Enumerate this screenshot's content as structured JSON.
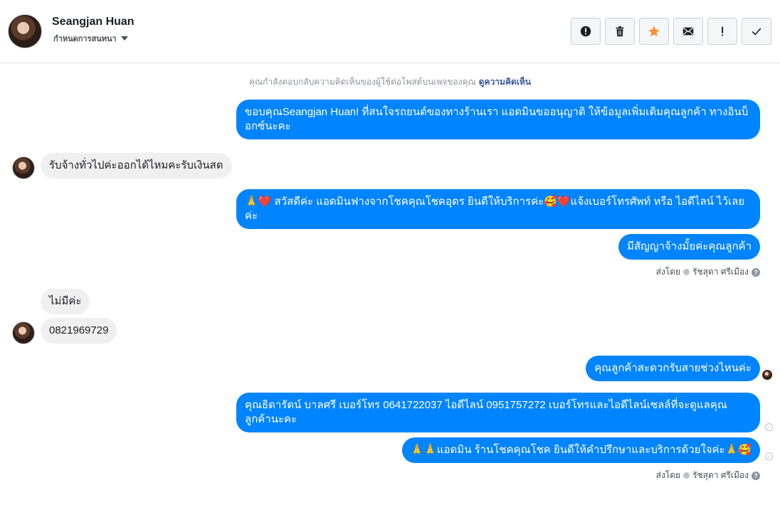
{
  "header": {
    "name": "Seangjan Huan",
    "subtitle": "กำหนดการสนทนา",
    "actions": [
      {
        "icon": "alert-circle-icon",
        "label": "report"
      },
      {
        "icon": "trash-icon",
        "label": "delete"
      },
      {
        "icon": "star-icon",
        "label": "star"
      },
      {
        "icon": "envelope-icon",
        "label": "mark unread"
      },
      {
        "icon": "exclamation-icon",
        "label": "spam"
      },
      {
        "icon": "checkmark-icon",
        "label": "done"
      }
    ],
    "star_color": "#f7923b"
  },
  "thread": {
    "notice_text": "คุณกำลังตอบกลับความคิดเห็นของผู้ใช้ต่อโพสต์บนเพจของคุณ",
    "notice_link": "ดูความคิดเห็น",
    "messages": [
      {
        "dir": "out",
        "text": "ขอบคุณSeangjan Huan! ที่สนใจรถยนต์ของทางร้านเรา แอดมินขออนุญาติ ให้ข้อมูลเพิ่มเติมคุณลูกค้า ทางอินบ็อกซ์นะคะ"
      },
      {
        "dir": "in",
        "text": "รับจ้างทั่วไปค่ะออกได้ไหมคะรับเงินสด"
      },
      {
        "dir": "out",
        "text": "🙏❤️ สวัสดีค่ะ แอดมินฟางจากโชคคุณโชคอุดร ยินดีให้บริการค่ะ🥰❤️แจ้งเบอร์โทรศัพท์ หรือ ไอดีไลน์  ไว้เลยค่ะ"
      },
      {
        "dir": "out",
        "text": "มีสัญญาจ้างมั้ยค่ะคุณลูกค้า"
      },
      {
        "dir": "in",
        "text": "ไม่มีค่ะ"
      },
      {
        "dir": "in",
        "text": "0821969729"
      },
      {
        "dir": "out",
        "text": "คุณลูกค้าสะดวกรับสายช่วงไหนค่ะ"
      },
      {
        "dir": "out",
        "text": "คุณธิดารัตน์ บาลศรี เบอร์โทร 0641722037  ไอดีไลน์ 0951757272   เบอร์โทรและไอดีไลน์เซลล์ที่จะดูแลคุณลูกค้านะคะ"
      },
      {
        "dir": "out",
        "text": "🙏🙏แอดมิน ร้านโชคคุณโชค ยินดีให้คำปรึกษาและบริการด้วยใจค่ะ🙏🥰"
      }
    ],
    "sent_by_label": "ส่งโดย",
    "sent_by_name": "รัชสุดา ศรีเมือง",
    "help_glyph": "?",
    "out_color": "#0084ff",
    "in_color": "#f1f0f0"
  }
}
